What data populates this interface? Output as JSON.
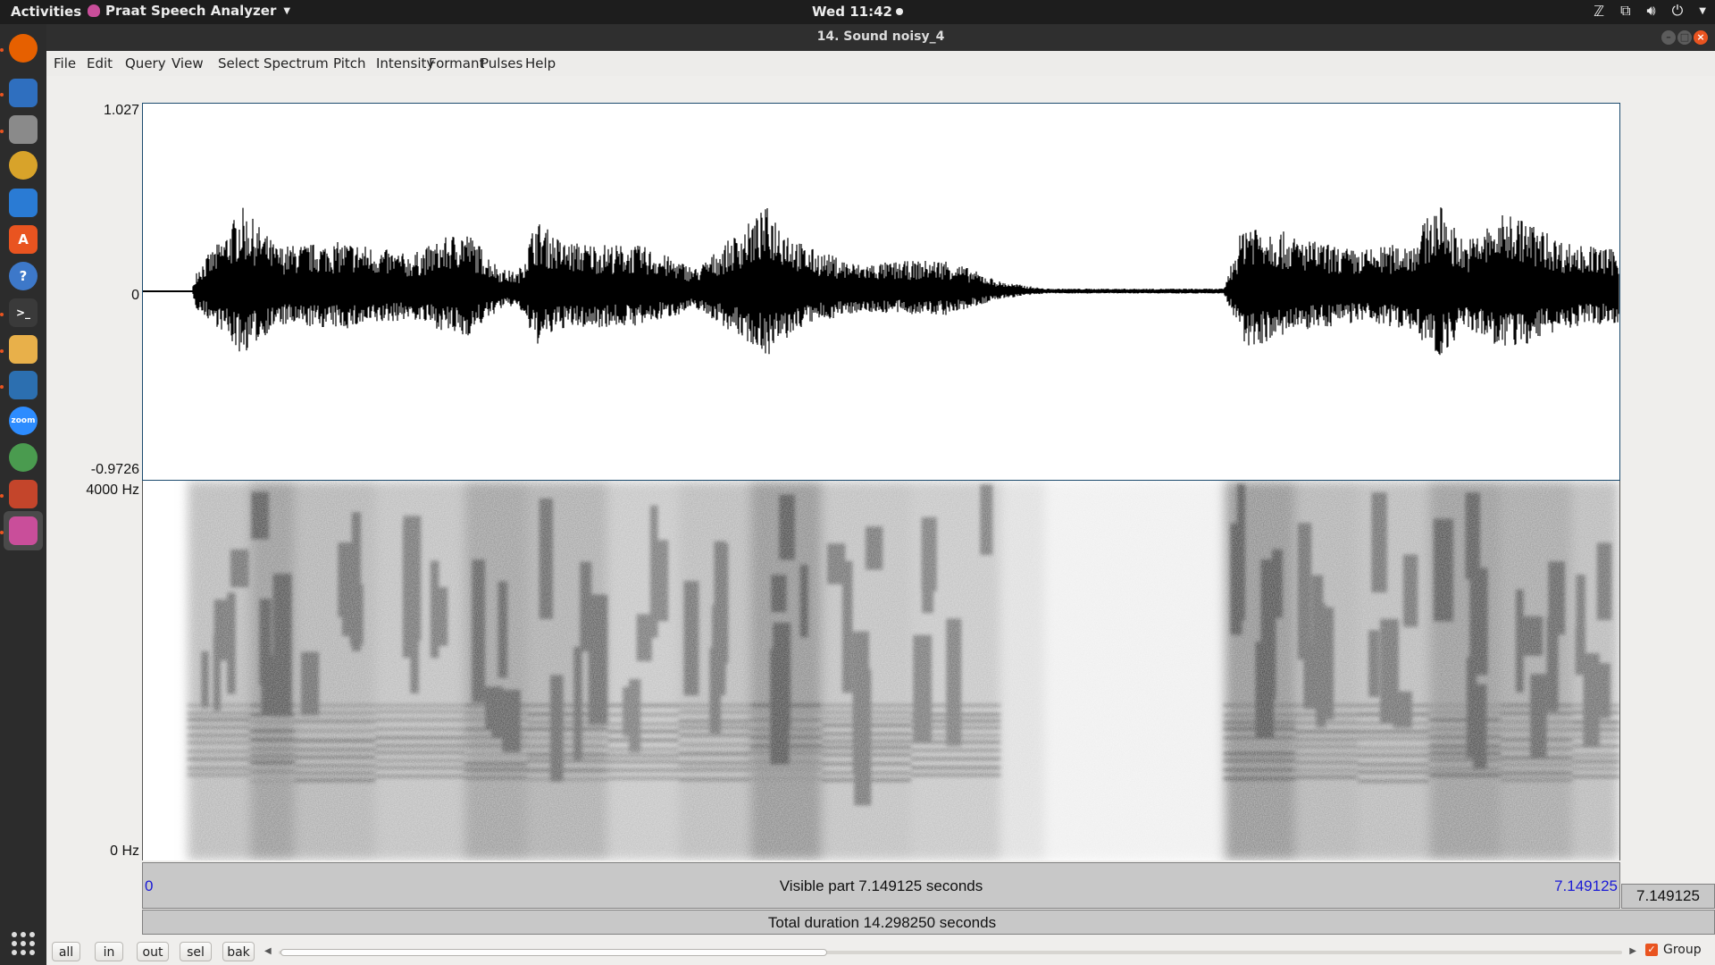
{
  "topbar": {
    "activities": "Activities",
    "app_name": "Praat Speech Analyzer",
    "clock": "Wed 11:42"
  },
  "dock": {
    "items": [
      {
        "name": "firefox-icon",
        "color": "#e66000"
      },
      {
        "name": "thunderbird-icon",
        "color": "#2f6fbf"
      },
      {
        "name": "files-icon",
        "color": "#8a8a8a"
      },
      {
        "name": "rhythmbox-icon",
        "color": "#d8a32a"
      },
      {
        "name": "libreoffice-writer-icon",
        "color": "#2a7bd4"
      },
      {
        "name": "software-center-icon",
        "color": "#e95420"
      },
      {
        "name": "help-icon",
        "color": "#3d78c9"
      },
      {
        "name": "terminal-icon",
        "color": "#3a3a3a"
      },
      {
        "name": "text-editor-icon",
        "color": "#e8b04a"
      },
      {
        "name": "app-icon",
        "color": "#2c6fb0"
      },
      {
        "name": "zoom-icon",
        "color": "#2d8cff"
      },
      {
        "name": "globe-icon",
        "color": "#4a9b4f"
      },
      {
        "name": "settings-icon",
        "color": "#c4452b"
      },
      {
        "name": "praat-icon",
        "color": "#c94e9a"
      }
    ],
    "zoom_label": "zoom"
  },
  "window": {
    "title": "14. Sound noisy_4"
  },
  "menu": [
    "File",
    "Edit",
    "Query",
    "View",
    "Select",
    "Spectrum",
    "Pitch",
    "Intensity",
    "Formant",
    "Pulses",
    "Help"
  ],
  "waveform": {
    "ymax_label": "1.027",
    "zero_label": "0",
    "ymin_label": "-0.9726"
  },
  "spectrogram": {
    "fmax_label": "4000 Hz",
    "fmin_label": "0 Hz"
  },
  "time": {
    "visible_start": "0",
    "visible_text": "Visible part 7.149125 seconds",
    "visible_end": "7.149125",
    "window_end": "7.149125",
    "total_text": "Total duration 14.298250 seconds"
  },
  "buttons": {
    "all": "all",
    "in": "in",
    "out": "out",
    "sel": "sel",
    "bak": "bak"
  },
  "group": {
    "label": "Group",
    "checked": true
  }
}
